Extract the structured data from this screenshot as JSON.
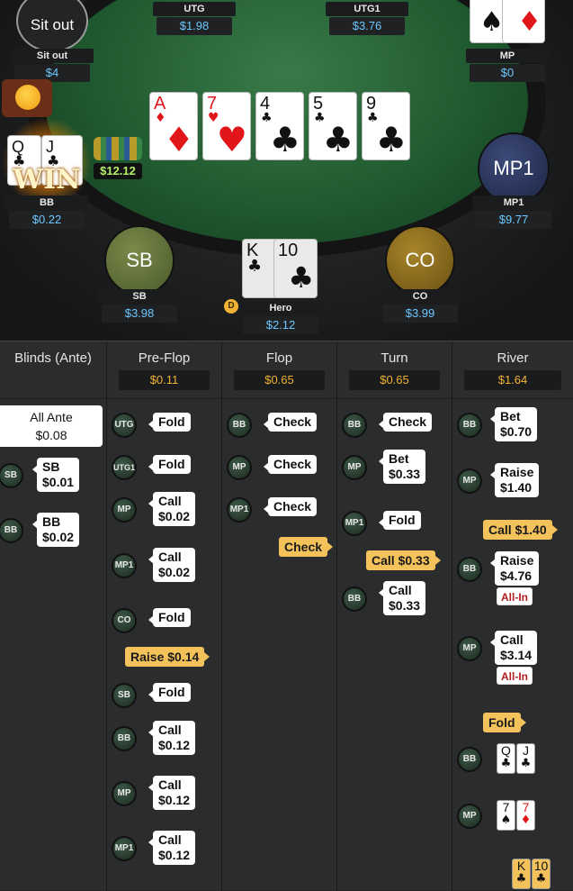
{
  "table": {
    "board": [
      {
        "rank": "A",
        "suit": "♦",
        "color": "red"
      },
      {
        "rank": "7",
        "suit": "♥",
        "color": "red"
      },
      {
        "rank": "4",
        "suit": "♣",
        "color": "blk"
      },
      {
        "rank": "5",
        "suit": "♣",
        "color": "blk"
      },
      {
        "rank": "9",
        "suit": "♣",
        "color": "blk"
      }
    ],
    "seats": {
      "sitout": {
        "button": "Sit out",
        "name": "Sit out",
        "stack": "$4"
      },
      "utg": {
        "name": "UTG",
        "stack": "$1.98"
      },
      "utg1": {
        "name": "UTG1",
        "stack": "$3.76"
      },
      "mp": {
        "name": "MP",
        "stack": "$0"
      },
      "mp1": {
        "avatar": "MP1",
        "name": "MP1",
        "stack": "$9.77"
      },
      "bb": {
        "name": "BB",
        "stack": "$0.22",
        "win_text": "WIN",
        "cards": [
          {
            "rank": "Q",
            "suit": "♣"
          },
          {
            "rank": "J",
            "suit": "♣"
          }
        ],
        "pot": "$12.12"
      },
      "sb": {
        "avatar": "SB",
        "name": "SB",
        "stack": "$3.98"
      },
      "hero": {
        "name": "Hero",
        "stack": "$2.12",
        "dealer": "D",
        "cards": [
          {
            "rank": "K",
            "suit": "♣"
          },
          {
            "rank": "10",
            "suit": "♣"
          }
        ]
      },
      "co": {
        "avatar": "CO",
        "name": "CO",
        "stack": "$3.99"
      }
    }
  },
  "history": {
    "columns": [
      {
        "title": "Blinds (Ante)",
        "pot": ""
      },
      {
        "title": "Pre-Flop",
        "pot": "$0.11"
      },
      {
        "title": "Flop",
        "pot": "$0.65"
      },
      {
        "title": "Turn",
        "pot": "$0.65"
      },
      {
        "title": "River",
        "pot": "$1.64"
      }
    ],
    "blinds": {
      "ante_label": "All Ante",
      "ante_value": "$0.08",
      "actions": [
        {
          "pos": "SB",
          "line1": "SB",
          "line2": "$0.01"
        },
        {
          "pos": "BB",
          "line1": "BB",
          "line2": "$0.02"
        }
      ]
    },
    "preflop": [
      {
        "pos": "UTG",
        "line1": "Fold",
        "line2": ""
      },
      {
        "pos": "UTG1",
        "line1": "Fold",
        "line2": ""
      },
      {
        "pos": "MP",
        "line1": "Call",
        "line2": "$0.02"
      },
      {
        "pos": "MP1",
        "line1": "Call",
        "line2": "$0.02"
      },
      {
        "pos": "CO",
        "line1": "Fold",
        "line2": ""
      },
      {
        "hero": "Raise $0.14"
      },
      {
        "pos": "SB",
        "line1": "Fold",
        "line2": ""
      },
      {
        "pos": "BB",
        "line1": "Call",
        "line2": "$0.12"
      },
      {
        "pos": "MP",
        "line1": "Call",
        "line2": "$0.12"
      },
      {
        "pos": "MP1",
        "line1": "Call",
        "line2": "$0.12"
      }
    ],
    "flop": [
      {
        "pos": "BB",
        "line1": "Check",
        "line2": ""
      },
      {
        "pos": "MP",
        "line1": "Check",
        "line2": ""
      },
      {
        "pos": "MP1",
        "line1": "Check",
        "line2": ""
      },
      {
        "hero": "Check"
      }
    ],
    "turn": [
      {
        "pos": "BB",
        "line1": "Check",
        "line2": ""
      },
      {
        "pos": "MP",
        "line1": "Bet",
        "line2": "$0.33"
      },
      {
        "pos": "MP1",
        "line1": "Fold",
        "line2": ""
      },
      {
        "hero": "Call $0.33"
      },
      {
        "pos": "BB",
        "line1": "Call",
        "line2": "$0.33"
      }
    ],
    "river": [
      {
        "pos": "BB",
        "line1": "Bet",
        "line2": "$0.70"
      },
      {
        "pos": "MP",
        "line1": "Raise",
        "line2": "$1.40"
      },
      {
        "hero": "Call $1.40"
      },
      {
        "pos": "BB",
        "line1": "Raise",
        "line2": "$4.76",
        "allin": "All-In"
      },
      {
        "pos": "MP",
        "line1": "Call",
        "line2": "$3.14",
        "allin": "All-In"
      },
      {
        "hero": "Fold"
      },
      {
        "pos": "BB",
        "cards": [
          {
            "r": "Q",
            "s": "♣"
          },
          {
            "r": "J",
            "s": "♣"
          }
        ]
      },
      {
        "pos": "MP",
        "cards": [
          {
            "r": "7",
            "s": "♠"
          },
          {
            "r": "7",
            "s": "♦"
          }
        ]
      },
      {
        "hero_cards": [
          {
            "r": "K",
            "s": "♣"
          },
          {
            "r": "10",
            "s": "♣"
          }
        ]
      }
    ]
  }
}
